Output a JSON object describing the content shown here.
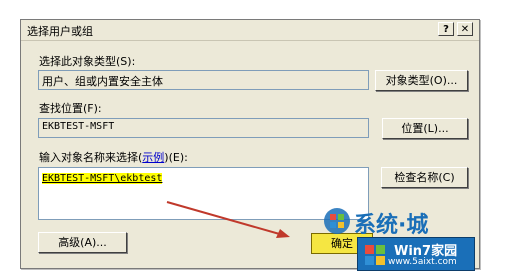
{
  "window": {
    "title": "选择用户或组",
    "help_glyph": "?",
    "close_glyph": "✕"
  },
  "object_type": {
    "label": "选择此对象类型(S):",
    "value": "用户、组或内置安全主体",
    "button": "对象类型(O)..."
  },
  "location": {
    "label": "查找位置(F):",
    "value": "EKBTEST-MSFT",
    "button": "位置(L)..."
  },
  "names": {
    "label_prefix": "输入对象名称来选择(",
    "label_link": "示例",
    "label_suffix": ")(E):",
    "value": "EKBTEST-MSFT\\ekbtest",
    "check_button": "检查名称(C)"
  },
  "buttons": {
    "advanced": "高级(A)...",
    "ok_partial": "确定"
  },
  "watermarks": {
    "xitongcheng": "系统·城",
    "win7_title": "Win7家园",
    "win7_url": "www.5aixt.com"
  },
  "colors": {
    "dialog_bg": "#ece9d8",
    "highlight": "#ffff00",
    "arrow": "#c0392b",
    "watermark_blue": "#1a6fb8"
  }
}
